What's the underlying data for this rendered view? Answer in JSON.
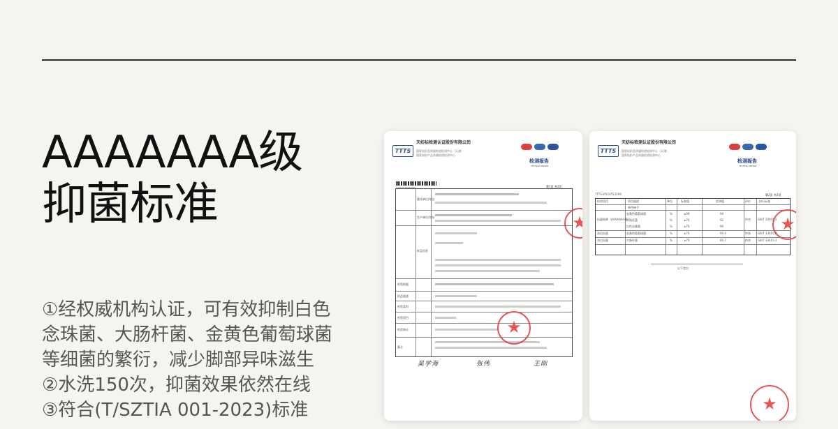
{
  "headline": {
    "line1": "AAAAAAA级",
    "line2": "抑菌标准"
  },
  "features": [
    "①经权威机构认证，可有效抑制白色",
    "念珠菌、大肠杆菌、金黄色葡萄球菌",
    "等细菌的繁衍，减少脚部异味滋生",
    "②水洗150次，抑菌效果依然在线",
    "③符合(T/SZTIA 001-2023)标准"
  ],
  "report1": {
    "company": "天纺标检测认证股份有限公司",
    "center": "国家纺织品质量检验检测中心（天津）",
    "center2": "国家纺织产品质量检验检测中心",
    "title": "检测报告",
    "subtitle": "TESTING REPORT",
    "page": "第1页  共2页",
    "barcode_number": "3303-0724553209",
    "labels": [
      "委托单位/地址",
      "生产单位/地址",
      "样品信息",
      "检验依据",
      "样品描述",
      "检验类别",
      "检验项目",
      "检验结论",
      "备注"
    ],
    "signatures": [
      "吴学海",
      "张伟",
      "王刚"
    ]
  },
  "report2": {
    "company": "天纺标检测认证股份有限公司",
    "center": "国家纺织品质量检验检测中心（天津）",
    "center2": "国家纺织产品质量检验检测中心",
    "title": "检测报告",
    "subtitle": "TESTING REPORT",
    "page": "第2页  共2页",
    "report_no": "TTTS-WY24553209",
    "columns": [
      "检验项目",
      "项目描述",
      "单位",
      "标准值",
      "实测值",
      "评价",
      "执行标准"
    ],
    "color": "单色袜子",
    "rows": [
      [
        "抗菌效果（AAAAAAA级）",
        "金黄色葡萄球菌",
        "%",
        "≥99",
        "99",
        "符合",
        "GB/T 20944.3"
      ],
      [
        "",
        "大肠杆菌",
        "%",
        "≥70",
        "92",
        "",
        ""
      ],
      [
        "",
        "白色念珠菌",
        "%",
        "≥70",
        "96",
        "",
        ""
      ],
      [
        "洗后抗菌",
        "金黄色葡萄球菌",
        "%",
        "≥70",
        "90.4",
        "符合",
        "GB/T 33610.2"
      ],
      [
        "洗后抗菌",
        "大肠杆菌",
        "%",
        "≥70",
        "80.7",
        "符合",
        "GB/T 33610.2"
      ]
    ],
    "footer": "以下空白"
  },
  "colors": {
    "background": "#f6f4ef",
    "stamp": "#e03b3b",
    "brand": "#2a4a8a"
  }
}
